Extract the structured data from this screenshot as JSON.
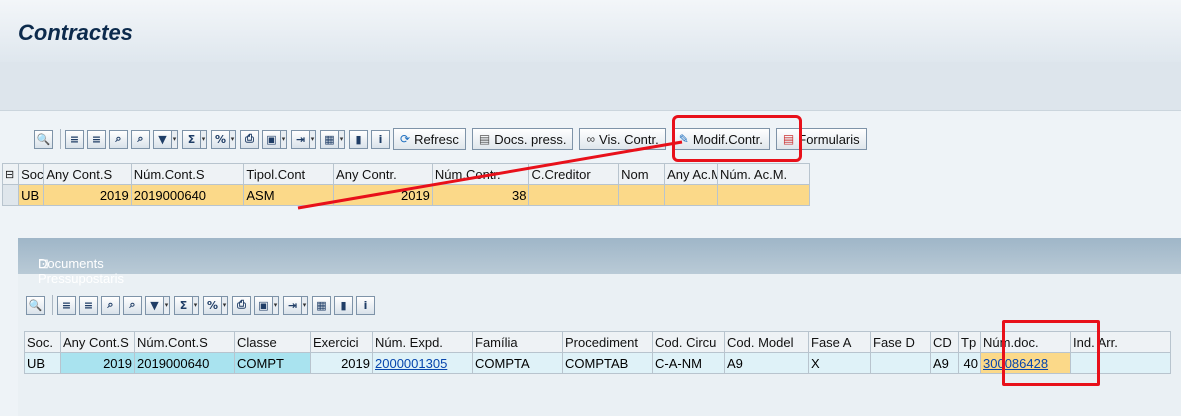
{
  "window": {
    "title": "Contractes"
  },
  "toolbar_buttons": {
    "refresc": "Refresc",
    "docs_press": "Docs. press.",
    "vis_contr": "Vis. Contr.",
    "modif_contr": "Modif.Contr.",
    "formularis": "Formularis"
  },
  "grid1": {
    "columns": [
      "Soc.",
      "Any Cont.S",
      "Núm.Cont.S",
      "Tipol.Cont",
      "Any Contr.",
      "Núm.Contr.",
      "C.Creditor",
      "Nom",
      "Any Ac.M.",
      "Núm. Ac.M."
    ],
    "row": [
      "UB",
      "2019",
      "2019000640",
      "ASM",
      "2019",
      "38",
      "",
      "",
      "",
      ""
    ]
  },
  "panel": {
    "title": "Documents Pressupostaris"
  },
  "grid2": {
    "columns": [
      "Soc.",
      "Any Cont.S",
      "Núm.Cont.S",
      "Classe",
      "Exercici",
      "Núm. Expd.",
      "Família",
      "Procediment",
      "Cod. Circu",
      "Cod. Model",
      "Fase A",
      "Fase D",
      "CD",
      "Tp",
      "Núm.doc.",
      "Ind. Arr."
    ],
    "row": [
      "UB",
      "2019",
      "2019000640",
      "COMPT",
      "2019",
      "2000001305",
      "COMPTA",
      "COMPTAB",
      "C-A-NM",
      "A9",
      "X",
      "",
      "A9",
      "40",
      "300086428",
      ""
    ]
  },
  "colors": {
    "highlight": "#e8101a",
    "selected_row": "#fbd989",
    "row2": "#dff2f8"
  }
}
